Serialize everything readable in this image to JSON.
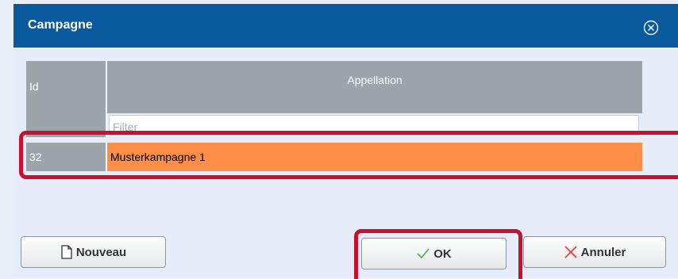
{
  "dialog": {
    "title": "Campagne"
  },
  "icons": {
    "close": "close-circle-icon",
    "new": "document-icon",
    "ok": "checkmark-icon",
    "cancel": "x-icon"
  },
  "colors": {
    "titlebar": "#095a9c",
    "header": "#9ea5aa",
    "selected_row": "#ff8f48",
    "highlight_annotation": "#c8102e"
  },
  "grid": {
    "columns": [
      "Id",
      "Appellation"
    ],
    "filter_placeholder": "Filter",
    "rows": [
      {
        "id": "32",
        "appellation": "Musterkampagne 1",
        "selected": true
      }
    ]
  },
  "buttons": {
    "new_label": "Nouveau",
    "ok_label": "OK",
    "cancel_label": "Annuler"
  }
}
